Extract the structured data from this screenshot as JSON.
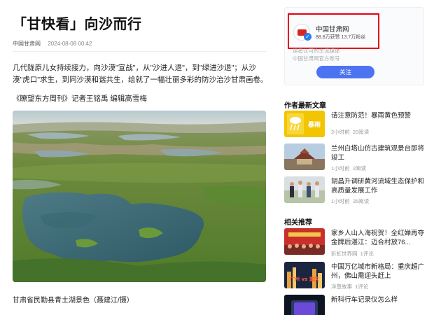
{
  "article": {
    "title": "「甘快看」向沙而行",
    "source": "中国甘肃网",
    "date": "2024-08-08 00:42",
    "para1": "几代陇原儿女持续接力，向沙漠\"宣战\"，从\"沙进人退\"，到\"绿进沙退\"；从沙漠\"虎口\"求生，到同沙漠和谐共生，绘就了一幅壮丽多彩的防沙治沙甘肃画卷。",
    "para2": "《瞭望东方周刊》记者王铭禹 编辑高雪梅",
    "caption": "甘肃省民勤县青土湖景色（聂建江/摄）"
  },
  "author": {
    "name": "中国甘肃网",
    "stats": "88.8万获赞 13.7万粉丝",
    "desc1": "读者认可的主流媒体",
    "desc2": "中国甘肃网官方账号",
    "follow": "关注"
  },
  "latest": {
    "heading": "作者最新文章",
    "items": [
      {
        "title": "请注意防范！暴雨黄色预警",
        "time": "2小时前",
        "reads": "20阅读"
      },
      {
        "title": "兰州白塔山仿古建筑观景台即将竣工",
        "time": "1小时前",
        "reads": "2阅读"
      },
      {
        "title": "胡昌升调研黄河流域生态保护和高质量发展工作",
        "time": "1小时前",
        "reads": "35阅读"
      }
    ]
  },
  "related": {
    "heading": "相关推荐",
    "items": [
      {
        "title": "家乡人山人海祝贺！全红婵再夺金牌后湛江：迈合村放76...",
        "time": "彩虹世界网",
        "reads": "1评论"
      },
      {
        "title": "中国万亿城市新格局：重庆超广州，佛山需迎头赶上",
        "time": "洋葱故事",
        "reads": "1评论"
      },
      {
        "title": "新科行车记录仪怎么样",
        "time": "",
        "reads": ""
      }
    ]
  },
  "thumb_texts": {
    "warning": "暴雨",
    "vs": "广州 vs 重庆"
  },
  "colors": {
    "accent": "#4c73f2",
    "highlight": "#e60012",
    "verify": "#2b7bec"
  }
}
